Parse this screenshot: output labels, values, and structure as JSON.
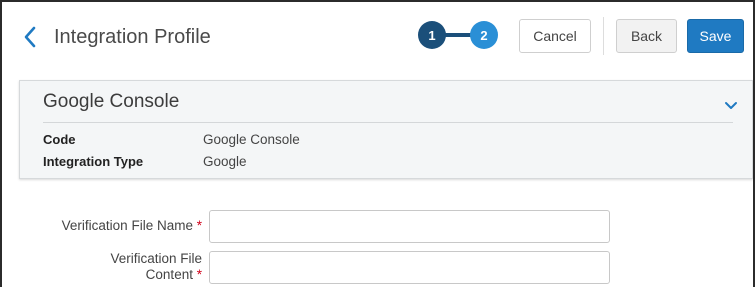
{
  "header": {
    "title": "Integration Profile",
    "back_icon": "chevron-left-icon",
    "steps": [
      "1",
      "2"
    ],
    "cancel_label": "Cancel",
    "back_label": "Back",
    "save_label": "Save"
  },
  "section": {
    "title": "Google Console",
    "toggle_icon": "chevron-down-icon",
    "fields": [
      {
        "label": "Code",
        "value": "Google Console"
      },
      {
        "label": "Integration Type",
        "value": "Google"
      }
    ]
  },
  "form": {
    "verification_file_name": {
      "label": "Verification File Name",
      "required": "*",
      "value": ""
    },
    "verification_file_content": {
      "label_line1": "Verification File",
      "label_line2": "Content",
      "required": "*",
      "value": ""
    }
  },
  "colors": {
    "primary": "#1f7ac2",
    "step_active": "#1b4f7a",
    "step_current": "#2a8fd6",
    "required": "#d0021b"
  }
}
